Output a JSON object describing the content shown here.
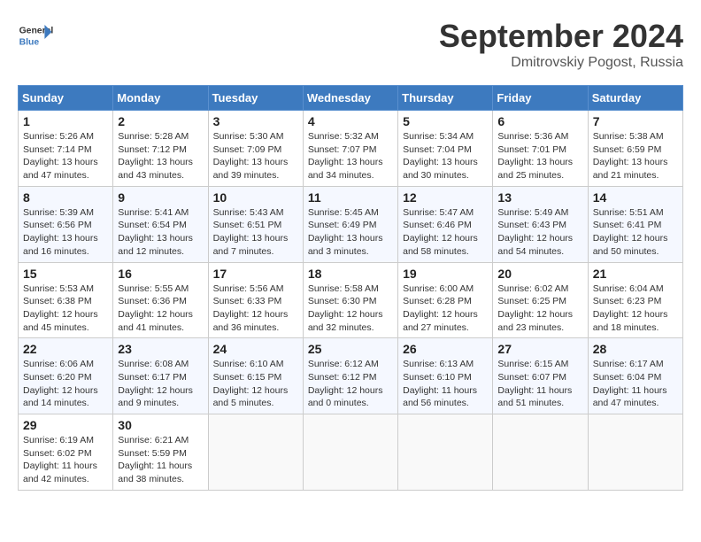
{
  "header": {
    "logo_line1": "General",
    "logo_line2": "Blue",
    "month": "September 2024",
    "location": "Dmitrovskiy Pogost, Russia"
  },
  "weekdays": [
    "Sunday",
    "Monday",
    "Tuesday",
    "Wednesday",
    "Thursday",
    "Friday",
    "Saturday"
  ],
  "weeks": [
    [
      {
        "day": "1",
        "info": "Sunrise: 5:26 AM\nSunset: 7:14 PM\nDaylight: 13 hours\nand 47 minutes."
      },
      {
        "day": "2",
        "info": "Sunrise: 5:28 AM\nSunset: 7:12 PM\nDaylight: 13 hours\nand 43 minutes."
      },
      {
        "day": "3",
        "info": "Sunrise: 5:30 AM\nSunset: 7:09 PM\nDaylight: 13 hours\nand 39 minutes."
      },
      {
        "day": "4",
        "info": "Sunrise: 5:32 AM\nSunset: 7:07 PM\nDaylight: 13 hours\nand 34 minutes."
      },
      {
        "day": "5",
        "info": "Sunrise: 5:34 AM\nSunset: 7:04 PM\nDaylight: 13 hours\nand 30 minutes."
      },
      {
        "day": "6",
        "info": "Sunrise: 5:36 AM\nSunset: 7:01 PM\nDaylight: 13 hours\nand 25 minutes."
      },
      {
        "day": "7",
        "info": "Sunrise: 5:38 AM\nSunset: 6:59 PM\nDaylight: 13 hours\nand 21 minutes."
      }
    ],
    [
      {
        "day": "8",
        "info": "Sunrise: 5:39 AM\nSunset: 6:56 PM\nDaylight: 13 hours\nand 16 minutes."
      },
      {
        "day": "9",
        "info": "Sunrise: 5:41 AM\nSunset: 6:54 PM\nDaylight: 13 hours\nand 12 minutes."
      },
      {
        "day": "10",
        "info": "Sunrise: 5:43 AM\nSunset: 6:51 PM\nDaylight: 13 hours\nand 7 minutes."
      },
      {
        "day": "11",
        "info": "Sunrise: 5:45 AM\nSunset: 6:49 PM\nDaylight: 13 hours\nand 3 minutes."
      },
      {
        "day": "12",
        "info": "Sunrise: 5:47 AM\nSunset: 6:46 PM\nDaylight: 12 hours\nand 58 minutes."
      },
      {
        "day": "13",
        "info": "Sunrise: 5:49 AM\nSunset: 6:43 PM\nDaylight: 12 hours\nand 54 minutes."
      },
      {
        "day": "14",
        "info": "Sunrise: 5:51 AM\nSunset: 6:41 PM\nDaylight: 12 hours\nand 50 minutes."
      }
    ],
    [
      {
        "day": "15",
        "info": "Sunrise: 5:53 AM\nSunset: 6:38 PM\nDaylight: 12 hours\nand 45 minutes."
      },
      {
        "day": "16",
        "info": "Sunrise: 5:55 AM\nSunset: 6:36 PM\nDaylight: 12 hours\nand 41 minutes."
      },
      {
        "day": "17",
        "info": "Sunrise: 5:56 AM\nSunset: 6:33 PM\nDaylight: 12 hours\nand 36 minutes."
      },
      {
        "day": "18",
        "info": "Sunrise: 5:58 AM\nSunset: 6:30 PM\nDaylight: 12 hours\nand 32 minutes."
      },
      {
        "day": "19",
        "info": "Sunrise: 6:00 AM\nSunset: 6:28 PM\nDaylight: 12 hours\nand 27 minutes."
      },
      {
        "day": "20",
        "info": "Sunrise: 6:02 AM\nSunset: 6:25 PM\nDaylight: 12 hours\nand 23 minutes."
      },
      {
        "day": "21",
        "info": "Sunrise: 6:04 AM\nSunset: 6:23 PM\nDaylight: 12 hours\nand 18 minutes."
      }
    ],
    [
      {
        "day": "22",
        "info": "Sunrise: 6:06 AM\nSunset: 6:20 PM\nDaylight: 12 hours\nand 14 minutes."
      },
      {
        "day": "23",
        "info": "Sunrise: 6:08 AM\nSunset: 6:17 PM\nDaylight: 12 hours\nand 9 minutes."
      },
      {
        "day": "24",
        "info": "Sunrise: 6:10 AM\nSunset: 6:15 PM\nDaylight: 12 hours\nand 5 minutes."
      },
      {
        "day": "25",
        "info": "Sunrise: 6:12 AM\nSunset: 6:12 PM\nDaylight: 12 hours\nand 0 minutes."
      },
      {
        "day": "26",
        "info": "Sunrise: 6:13 AM\nSunset: 6:10 PM\nDaylight: 11 hours\nand 56 minutes."
      },
      {
        "day": "27",
        "info": "Sunrise: 6:15 AM\nSunset: 6:07 PM\nDaylight: 11 hours\nand 51 minutes."
      },
      {
        "day": "28",
        "info": "Sunrise: 6:17 AM\nSunset: 6:04 PM\nDaylight: 11 hours\nand 47 minutes."
      }
    ],
    [
      {
        "day": "29",
        "info": "Sunrise: 6:19 AM\nSunset: 6:02 PM\nDaylight: 11 hours\nand 42 minutes."
      },
      {
        "day": "30",
        "info": "Sunrise: 6:21 AM\nSunset: 5:59 PM\nDaylight: 11 hours\nand 38 minutes."
      },
      {
        "day": "",
        "info": ""
      },
      {
        "day": "",
        "info": ""
      },
      {
        "day": "",
        "info": ""
      },
      {
        "day": "",
        "info": ""
      },
      {
        "day": "",
        "info": ""
      }
    ]
  ]
}
